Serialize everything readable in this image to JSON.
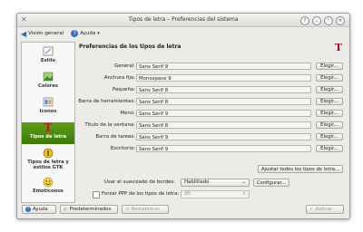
{
  "window": {
    "title": "Tipos de letra – Preferencias del sistema"
  },
  "toolbar": {
    "overview_label": "Visión general",
    "help_label": "Ayuda"
  },
  "sidebar": {
    "items": [
      {
        "label": "Estilo",
        "icon": "style-icon"
      },
      {
        "label": "Colores",
        "icon": "colors-icon"
      },
      {
        "label": "Iconos",
        "icon": "icons-icon"
      },
      {
        "label": "Tipos de letra",
        "icon": "fonts-icon",
        "active": true
      },
      {
        "label": "Tipos de letra y estilos GTK",
        "icon": "gtk-fonts-icon"
      },
      {
        "label": "Emoticonos",
        "icon": "emoticons-icon"
      }
    ]
  },
  "main": {
    "section_title": "Preferencias de los tipos de letra",
    "fonts": [
      {
        "label": "General:",
        "value": "Sans Serif  9"
      },
      {
        "label": "Anchura fija:",
        "value": "Monospace  9"
      },
      {
        "label": "Pequeña:",
        "value": "Sans Serif  8"
      },
      {
        "label": "Barra de herramientas:",
        "value": "Sans Serif  8"
      },
      {
        "label": "Menú:",
        "value": "Sans Serif  9"
      },
      {
        "label": "Título de la ventana:",
        "value": "Sans Serif  8"
      },
      {
        "label": "Barra de tareas:",
        "value": "Sans Serif  9"
      },
      {
        "label": "Escritorio:",
        "value": "Sans Serif  9"
      }
    ],
    "choose_label": "Elegir...",
    "adjust_all_label": "Ajustar todos los tipos de letra...",
    "antialias_label": "Usar el suavizado de bordes:",
    "antialias_value": "Habilitado",
    "configure_label": "Configurar...",
    "force_dpi_label": "Forzar PPP de los tipos de letra:",
    "force_dpi_value": "96"
  },
  "bottom": {
    "help_label": "Ayuda",
    "defaults_label": "Predeterminados",
    "reset_label": "Restablecer",
    "apply_label": "Aplicar"
  },
  "colors": {
    "active_item": "#4a8a12",
    "accent_red": "#a0151b",
    "help_blue": "#3c6fc0"
  }
}
